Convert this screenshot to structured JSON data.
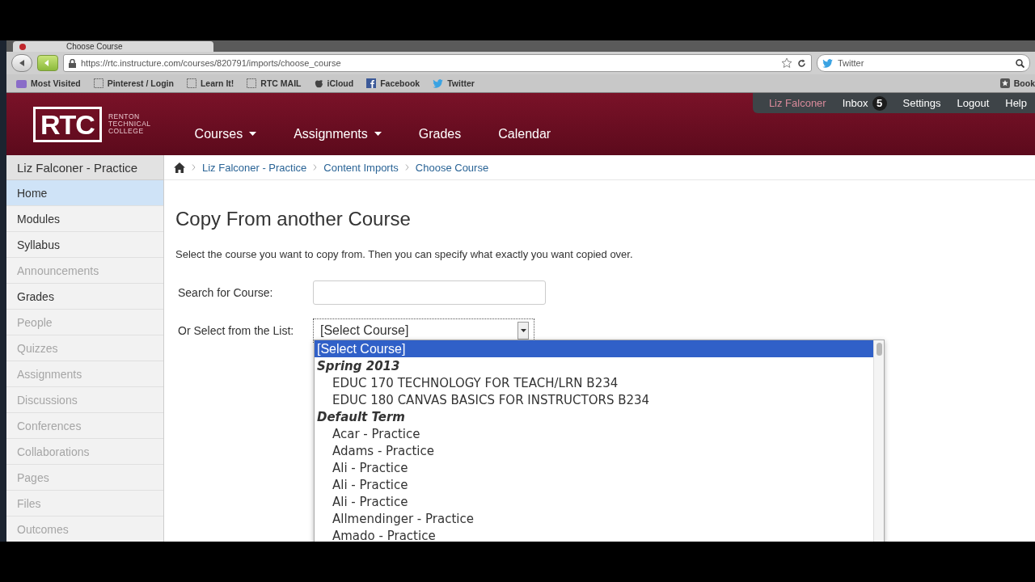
{
  "browser": {
    "tab_title": "Choose Course",
    "url": "https://rtc.instructure.com/courses/820791/imports/choose_course",
    "search_placeholder": "Twitter",
    "bookmarks": [
      {
        "label": "Most Visited",
        "kind": "folder"
      },
      {
        "label": "Pinterest / Login",
        "kind": "page"
      },
      {
        "label": "Learn It!",
        "kind": "page"
      },
      {
        "label": "RTC MAIL",
        "kind": "page"
      },
      {
        "label": "iCloud",
        "kind": "apple"
      },
      {
        "label": "Facebook",
        "kind": "facebook"
      },
      {
        "label": "Twitter",
        "kind": "twitter"
      },
      {
        "label": "Book",
        "kind": "star"
      }
    ]
  },
  "header": {
    "logo": {
      "initials": "RTC",
      "lines": [
        "RENTON",
        "TECHNICAL",
        "COLLEGE"
      ]
    },
    "nav": [
      {
        "label": "Courses",
        "dropdown": true
      },
      {
        "label": "Assignments",
        "dropdown": true
      },
      {
        "label": "Grades",
        "dropdown": false
      },
      {
        "label": "Calendar",
        "dropdown": false
      }
    ],
    "user_menu": {
      "user": "Liz Falconer",
      "inbox": "Inbox",
      "inbox_count": "5",
      "links": [
        "Settings",
        "Logout",
        "Help"
      ]
    }
  },
  "sidebar": {
    "title": "Liz Falconer - Practice",
    "items": [
      {
        "label": "Home",
        "selected": true,
        "disabled": false
      },
      {
        "label": "Modules",
        "selected": false,
        "disabled": false
      },
      {
        "label": "Syllabus",
        "selected": false,
        "disabled": false
      },
      {
        "label": "Announcements",
        "selected": false,
        "disabled": true
      },
      {
        "label": "Grades",
        "selected": false,
        "disabled": false
      },
      {
        "label": "People",
        "selected": false,
        "disabled": true
      },
      {
        "label": "Quizzes",
        "selected": false,
        "disabled": true
      },
      {
        "label": "Assignments",
        "selected": false,
        "disabled": true
      },
      {
        "label": "Discussions",
        "selected": false,
        "disabled": true
      },
      {
        "label": "Conferences",
        "selected": false,
        "disabled": true
      },
      {
        "label": "Collaborations",
        "selected": false,
        "disabled": true
      },
      {
        "label": "Pages",
        "selected": false,
        "disabled": true
      },
      {
        "label": "Files",
        "selected": false,
        "disabled": true
      },
      {
        "label": "Outcomes",
        "selected": false,
        "disabled": true
      }
    ]
  },
  "breadcrumbs": [
    "Liz Falconer - Practice",
    "Content Imports",
    "Choose Course"
  ],
  "page": {
    "heading": "Copy From another Course",
    "intro": "Select the course you want to copy from. Then you can specify what exactly you want copied over.",
    "search_label": "Search for Course:",
    "select_label": "Or Select from the List:",
    "select_value": "[Select Course]",
    "options": [
      {
        "kind": "option",
        "label": "[Select Course]",
        "selected": true
      },
      {
        "kind": "group",
        "label": "Spring 2013",
        "children": [
          {
            "label": "EDUC 170 TECHNOLOGY FOR TEACH/LRN B234",
            "selected": false
          },
          {
            "label": "EDUC 180 CANVAS BASICS FOR INSTRUCTORS B234",
            "selected": false
          }
        ]
      },
      {
        "kind": "group",
        "label": "Default Term",
        "children": [
          {
            "label": "Acar - Practice",
            "selected": false
          },
          {
            "label": "Adams - Practice",
            "selected": false
          },
          {
            "label": "Ali - Practice",
            "selected": false
          },
          {
            "label": "Ali - Practice",
            "selected": false
          },
          {
            "label": "Ali - Practice",
            "selected": false
          },
          {
            "label": "Allmendinger - Practice",
            "selected": false
          },
          {
            "label": "Amado - Practice",
            "selected": false
          }
        ]
      }
    ]
  }
}
